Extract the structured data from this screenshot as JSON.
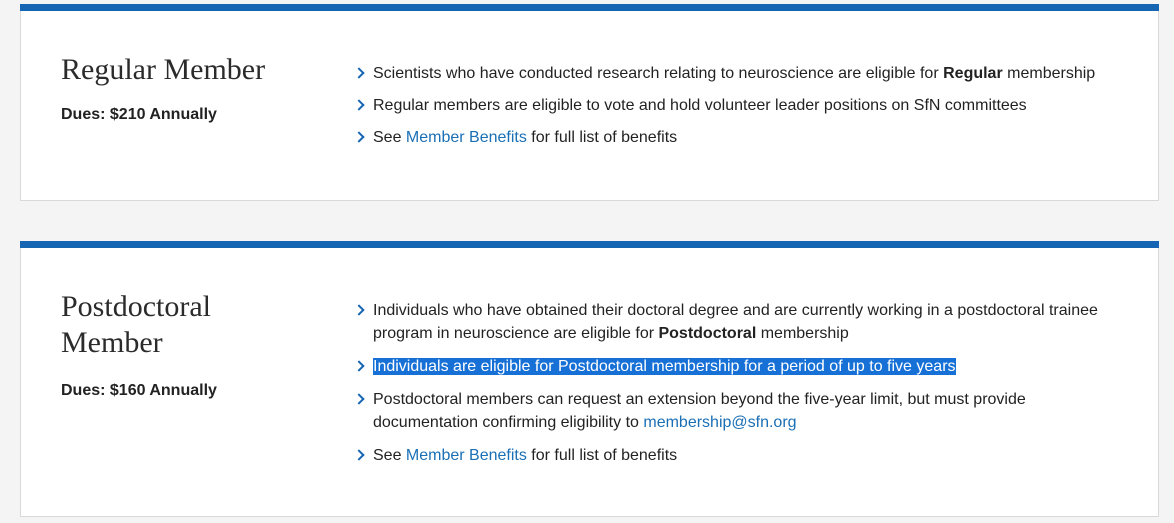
{
  "regular": {
    "title": "Regular Member",
    "dues": "Dues: $210 Annually",
    "bullets": {
      "b1_pre": "Scientists who have conducted research relating to neuroscience are eligible for ",
      "b1_bold": "Regular",
      "b1_post": " membership",
      "b2": "Regular members are eligible to vote and hold volunteer leader positions on SfN committees",
      "b3_pre": "See ",
      "b3_link": "Member Benefits",
      "b3_post": " for full list of benefits"
    }
  },
  "postdoc": {
    "title_line1": "Postdoctoral",
    "title_line2": "Member",
    "dues": "Dues: $160 Annually",
    "bullets": {
      "b1_pre": "Individuals who have obtained their doctoral degree and are currently working in a postdoctoral trainee program in neuroscience are eligible for ",
      "b1_bold": "Postdoctoral",
      "b1_post": " membership",
      "b2": "Individuals are eligible for Postdoctoral membership for a period of up to five years",
      "b3_pre": "Postdoctoral members can request an extension beyond the five-year limit, but must provide documentation confirming eligibility to ",
      "b3_link": "membership@sfn.org",
      "b4_pre": "See ",
      "b4_link": "Member Benefits",
      "b4_post": " for full list of benefits"
    }
  },
  "colors": {
    "accent_bar": "#1565b2",
    "link": "#1a6fb5",
    "selection": "#1670d6"
  }
}
